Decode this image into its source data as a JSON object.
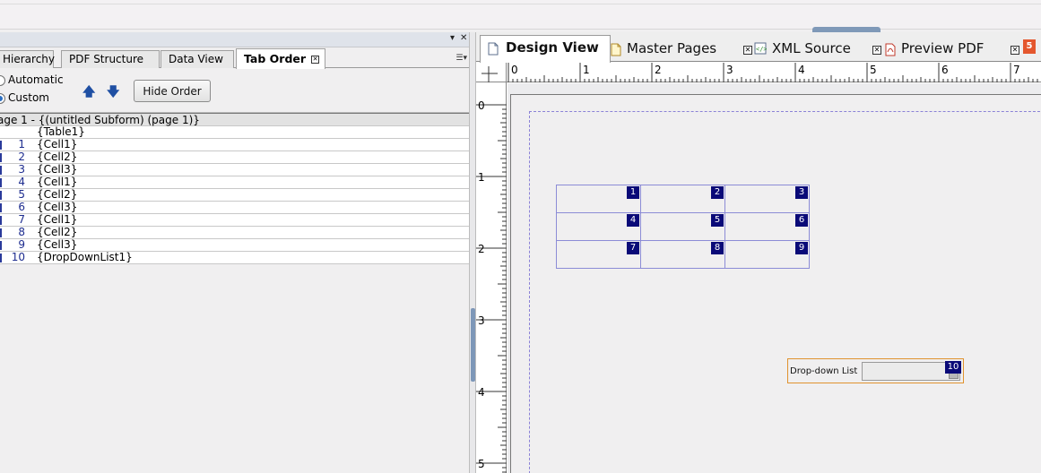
{
  "left_panel": {
    "tabs": [
      {
        "label": "Hierarchy"
      },
      {
        "label": "PDF Structure"
      },
      {
        "label": "Data View"
      },
      {
        "label": "Tab Order",
        "active": true
      }
    ],
    "options": {
      "automatic": "Automatic",
      "custom": "Custom",
      "selected": "custom"
    },
    "hide_order_label": "Hide Order",
    "tree": {
      "page_label": "age 1 - {(untitled Subform) (page 1)}",
      "table_label": "{Table1}",
      "items": [
        {
          "n": "1",
          "label": "{Cell1}"
        },
        {
          "n": "2",
          "label": "{Cell2}"
        },
        {
          "n": "3",
          "label": "{Cell3}"
        },
        {
          "n": "4",
          "label": "{Cell1}"
        },
        {
          "n": "5",
          "label": "{Cell2}"
        },
        {
          "n": "6",
          "label": "{Cell3}"
        },
        {
          "n": "7",
          "label": "{Cell1}"
        },
        {
          "n": "8",
          "label": "{Cell2}"
        },
        {
          "n": "9",
          "label": "{Cell3}"
        },
        {
          "n": "10",
          "label": "{DropDownList1}"
        }
      ]
    }
  },
  "right_panel": {
    "tabs": [
      {
        "label": "Design View",
        "active": true,
        "icon": "page-icon"
      },
      {
        "label": "Master Pages",
        "icon": "master-page-icon"
      },
      {
        "label": "XML Source",
        "icon": "xml-icon"
      },
      {
        "label": "Preview PDF",
        "icon": "pdf-icon"
      }
    ],
    "hruler_labels": [
      "0",
      "1",
      "2",
      "3",
      "4",
      "5",
      "6",
      "7"
    ],
    "vruler_labels": [
      "0",
      "1",
      "2",
      "3",
      "4",
      "5"
    ],
    "cells": [
      "1",
      "2",
      "3",
      "4",
      "5",
      "6",
      "7",
      "8",
      "9"
    ],
    "dropdown": {
      "label": "Drop-down List",
      "order": "10"
    }
  },
  "colors": {
    "badge": "#0a0a78",
    "selection": "#e0922f",
    "cell_border": "#8c8cd6"
  }
}
